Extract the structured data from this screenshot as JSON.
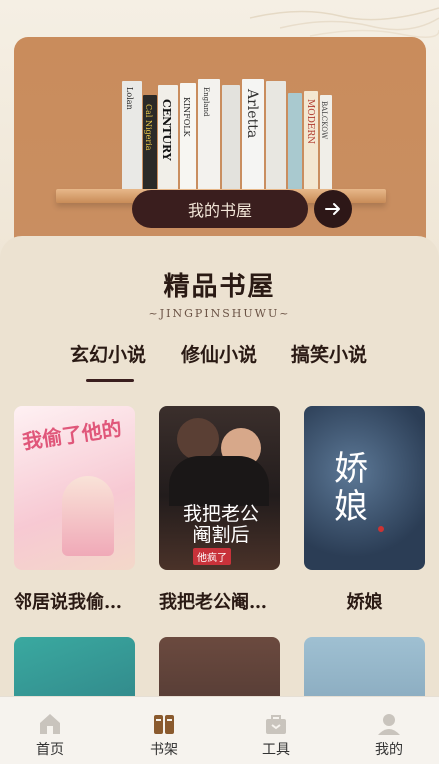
{
  "banner": {
    "my_shelf_label": "我的书屋",
    "spine_titles": [
      "Lolan",
      "Cal Nigeria",
      "CENTURY",
      "KINFOLK",
      "England",
      "Arletta",
      "MODERN",
      "BALCKOW"
    ]
  },
  "section": {
    "title": "精品书屋",
    "subtitle": "~JINGPINSHUWU~",
    "tabs": [
      "玄幻小说",
      "修仙小说",
      "搞笑小说"
    ],
    "active_tab": "玄幻小说"
  },
  "books": [
    {
      "title": "邻居说我偷…",
      "cover_text": "我偷了他的",
      "cover_colors": [
        "#fde6ea",
        "#f6c7d1"
      ]
    },
    {
      "title": "我把老公阉…",
      "cover_text": "我把老公阉割后",
      "cover_badge": "他疯了",
      "cover_colors": [
        "#2b2424",
        "#6b4a3e"
      ]
    },
    {
      "title": "娇娘",
      "cover_text": "娇娘",
      "cover_colors": [
        "#2c3d56",
        "#4a6280"
      ]
    }
  ],
  "bottom_nav": {
    "items": [
      {
        "label": "首页",
        "icon": "home-icon"
      },
      {
        "label": "书架",
        "icon": "bookshelf-icon",
        "active": true
      },
      {
        "label": "工具",
        "icon": "toolbox-icon"
      },
      {
        "label": "我的",
        "icon": "user-icon"
      }
    ]
  }
}
